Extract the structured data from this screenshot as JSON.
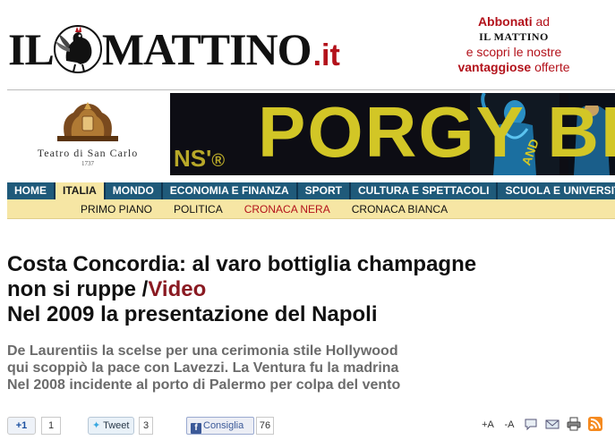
{
  "masthead": {
    "logo_il": "IL",
    "logo_mattino": "MATTINO",
    "logo_tld": ".it",
    "promo": {
      "line1_bold": "Abbonati",
      "line1_rest": " ad",
      "line2": "IL MATTINO",
      "line3": "e scopri le nostre",
      "line4_bold": "vantaggiose",
      "line4_rest": " offerte"
    }
  },
  "banner": {
    "theatre_name": "Teatro di San Carlo",
    "theatre_year": "1737",
    "show_title": "PORGY",
    "show_title_tail": "BE",
    "show_prefix": "NS'",
    "show_reg": "®",
    "show_and": "AND"
  },
  "nav": {
    "items": [
      {
        "label": "HOME"
      },
      {
        "label": "ITALIA"
      },
      {
        "label": "MONDO"
      },
      {
        "label": "ECONOMIA E FINANZA"
      },
      {
        "label": "SPORT"
      },
      {
        "label": "CULTURA E SPETTACOLI"
      },
      {
        "label": "SCUOLA E UNIVERSITÀ"
      }
    ],
    "active_index": 1,
    "subitems": [
      {
        "label": "PRIMO PIANO"
      },
      {
        "label": "POLITICA"
      },
      {
        "label": "CRONACA NERA"
      },
      {
        "label": "CRONACA BIANCA"
      }
    ],
    "current_sub_index": 2
  },
  "article": {
    "title_line1": "Costa Concordia: al varo bottiglia champagne",
    "title_line2": "non si ruppe /",
    "title_video": "Video",
    "title_line3": "Nel 2009 la presentazione del Napoli",
    "summary": [
      "De Laurentiis la scelse per una cerimonia stile Hollywood",
      "qui scoppiò la pace con Lavezzi. La Ventura fu la madrina",
      "Nel 2008 incidente al porto di Palermo per colpa del vento"
    ]
  },
  "social": {
    "gplus_label": "+1",
    "gplus_count": "1",
    "tweet_label": "Tweet",
    "tweet_count": "3",
    "fb_label": "Consiglia",
    "fb_count": "76",
    "tools": [
      {
        "label": "+A",
        "icon": "font-increase-icon"
      },
      {
        "label": "-A",
        "icon": "font-decrease-icon"
      },
      {
        "label": "",
        "icon": "comment-icon"
      },
      {
        "label": "",
        "icon": "email-icon"
      },
      {
        "label": "",
        "icon": "print-icon"
      },
      {
        "label": "",
        "icon": "rss-icon"
      }
    ]
  },
  "colors": {
    "brand_red": "#b3121b",
    "nav_blue": "#1f5a7a",
    "subnav_yellow": "#f6e6a4",
    "summary_grey": "#6b6b6b",
    "video_red": "#8a1a22"
  }
}
